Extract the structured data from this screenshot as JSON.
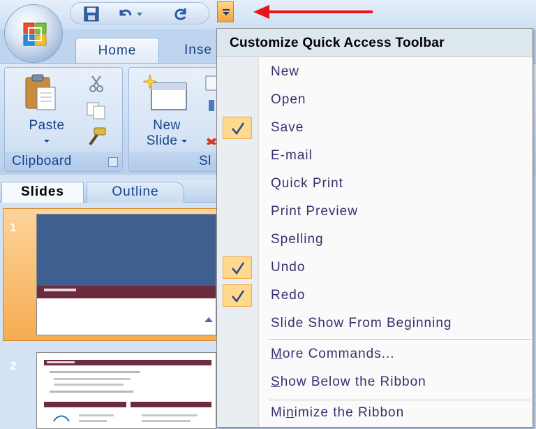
{
  "ribbon": {
    "tabs": [
      {
        "label": "Home",
        "active": true
      },
      {
        "label": "Inse",
        "active": false
      }
    ],
    "groups": {
      "clipboard": {
        "label": "Clipboard",
        "paste_label": "Paste"
      },
      "slides": {
        "label": "Sl",
        "new_slide_line1": "New",
        "new_slide_line2": "Slide"
      }
    }
  },
  "pane": {
    "tabs": [
      {
        "label": "Slides",
        "active": true
      },
      {
        "label": "Outline",
        "active": false
      }
    ],
    "slides": [
      {
        "number": "1",
        "selected": true
      },
      {
        "number": "2",
        "selected": false
      }
    ]
  },
  "menu": {
    "title": "Customize Quick Access Toolbar",
    "items": [
      {
        "label": "New",
        "checked": false
      },
      {
        "label": "Open",
        "checked": false
      },
      {
        "label": "Save",
        "checked": true
      },
      {
        "label": "E-mail",
        "checked": false
      },
      {
        "label": "Quick Print",
        "checked": false
      },
      {
        "label": "Print Preview",
        "checked": false
      },
      {
        "label": "Spelling",
        "checked": false
      },
      {
        "label": "Undo",
        "checked": true
      },
      {
        "label": "Redo",
        "checked": true
      },
      {
        "label": "Slide Show From Beginning",
        "checked": false
      }
    ],
    "more_commands": {
      "accel": "M",
      "rest": "ore Commands..."
    },
    "show_below": {
      "accel": "S",
      "rest": "how Below the Ribbon"
    },
    "minimize": {
      "pre": "Mi",
      "accel": "n",
      "rest": "imize the Ribbon"
    }
  },
  "colors": {
    "accent_orange": "#f2a33a",
    "check_bg": "#ffd98e",
    "arrow_red": "#e8141c",
    "ribbon_text": "#15428b"
  },
  "icons": [
    "office-button-icon",
    "save-icon",
    "undo-icon",
    "redo-icon",
    "customize-dropdown-icon",
    "paste-icon",
    "cut-icon",
    "copy-icon",
    "format-painter-icon",
    "new-slide-icon",
    "checkmark-icon"
  ]
}
